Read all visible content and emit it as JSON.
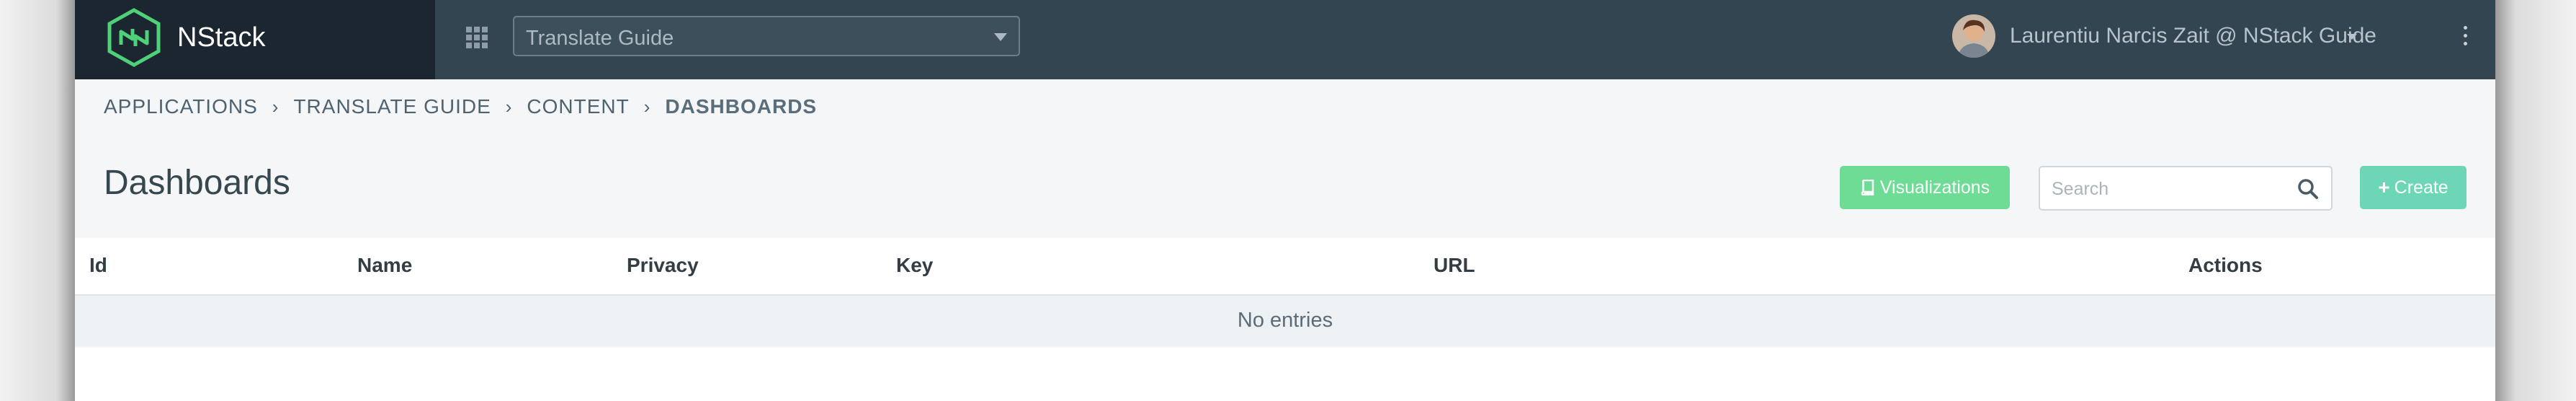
{
  "brand": {
    "name": "NStack"
  },
  "app_select": {
    "value": "Translate Guide"
  },
  "user": {
    "label": "Laurentiu Narcis Zait @ NStack Guide"
  },
  "breadcrumb": [
    "APPLICATIONS",
    "TRANSLATE GUIDE",
    "CONTENT",
    "DASHBOARDS"
  ],
  "breadcrumb_separator": "›",
  "page": {
    "title": "Dashboards"
  },
  "toolbar": {
    "visualizations_label": "Visualizations",
    "search_placeholder": "Search",
    "create_label": "Create"
  },
  "table": {
    "columns": [
      "Id",
      "Name",
      "Privacy",
      "Key",
      "URL",
      "Actions"
    ],
    "empty_text": "No entries"
  },
  "colors": {
    "topbar": "#344552",
    "brand_bg": "#1b2630",
    "visualizations_button": "#6fdc95",
    "create_button": "#6dd6b7",
    "logo_green": "#4fd17a"
  },
  "icons": [
    "nstack-logo-icon",
    "apps-grid-icon",
    "chevron-down-icon",
    "avatar",
    "kebab-menu-icon",
    "book-icon",
    "search-icon",
    "plus-icon"
  ]
}
